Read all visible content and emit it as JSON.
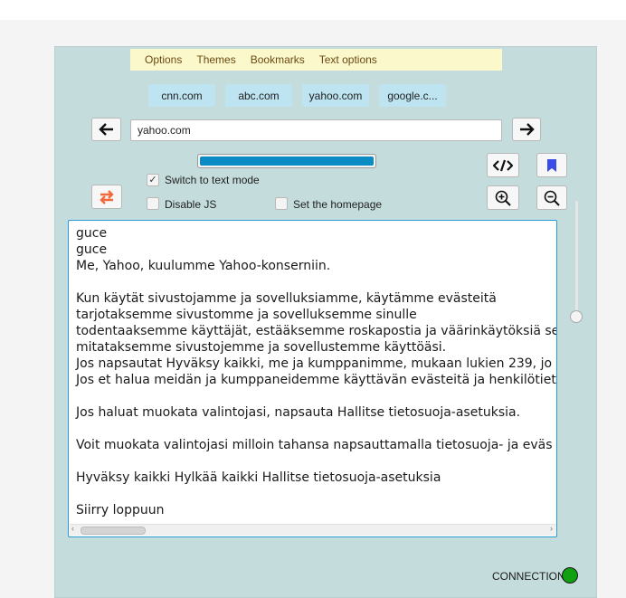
{
  "menu": {
    "items": [
      "Options",
      "Themes",
      "Bookmarks",
      "Text options"
    ]
  },
  "quick_links": [
    "cnn.com",
    "abc.com",
    "yahoo.com",
    "google.c..."
  ],
  "nav": {
    "back_icon": "arrow-left-icon",
    "forward_icon": "arrow-right-icon",
    "url_value": "yahoo.com"
  },
  "progress": {
    "value": 1.0,
    "color": "#0a8bc4"
  },
  "toolbar": {
    "source_icon": "code-icon",
    "bookmark_icon": "bookmark-icon",
    "zoom_in_icon": "zoom-in-icon",
    "zoom_out_icon": "zoom-out-icon",
    "reload_icon": "swap-icon"
  },
  "options": {
    "text_mode_label": "Switch to text mode",
    "text_mode_checked": true,
    "disable_js_label": "Disable JS",
    "disable_js_checked": false,
    "homepage_label": "Set the homepage",
    "homepage_checked": false
  },
  "content": {
    "text": "guce\nguce\nMe, Yahoo, kuulumme Yahoo-konserniin.\n\nKun käytät sivustojamme ja sovelluksiamme, käytämme evästeitä\ntarjotaksemme sivustomme ja sovelluksemme sinulle\ntodentaaksemme käyttäjät, estääksemme roskapostia ja väärinkäytöksiä se\nmitataksemme sivustojemme ja sovellustemme käyttöäsi.\nJos napsautat Hyväksy kaikki, me ja kumppanimme, mukaan lukien 239, jo\nJos et halua meidän ja kumppaneidemme käyttävän evästeitä ja henkilötiet\n\nJos haluat muokata valintojasi, napsauta Hallitse tietosuoja-asetuksia.\n\nVoit muokata valintojasi milloin tahansa napsauttamalla tietosuoja- ja eväs\n\nHyväksy kaikki Hylkää kaikki Hallitse tietosuoja-asetuksia\n\nSiirry loppuun"
  },
  "zoom_slider": {
    "value": 0.0
  },
  "status": {
    "label": "CONNECTION",
    "color": "#11a011"
  },
  "colors": {
    "panel": "#c5dcdc",
    "menu_bg": "#fbf8cc",
    "link_bg": "#bde4f0",
    "reload_accent": "#f26a3a",
    "bookmark_accent": "#3b4de8"
  }
}
